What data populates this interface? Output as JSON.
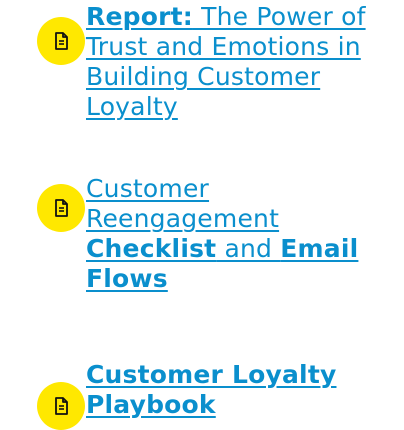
{
  "resources": [
    {
      "icon": "document-icon",
      "bold_prefix": "Report:",
      "title_rest": " The Power of Trust and Emotions in Building Customer Loyalty"
    },
    {
      "icon": "document-icon",
      "part1": "Customer Reengagement ",
      "part2_bold": "Checklist",
      "part3": " and ",
      "part4_bold": "Email Flows"
    },
    {
      "icon": "document-icon",
      "title_bold": "Customer Loyalty Playbook"
    }
  ],
  "colors": {
    "link": "#0a8fcd",
    "icon_background": "#ffe800",
    "icon_glyph": "#111111"
  }
}
